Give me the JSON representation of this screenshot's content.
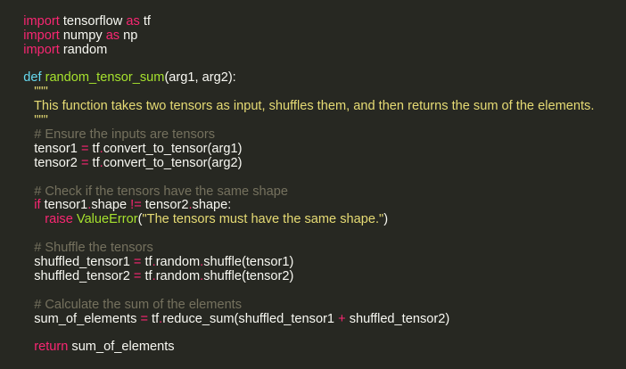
{
  "code": {
    "lines": [
      "import tensorflow as tf",
      "import numpy as np",
      "import random",
      "",
      "def random_tensor_sum(arg1, arg2):",
      "\"\"\"",
      "This function takes two tensors as input, shuffles them, and then returns the sum of the elements.",
      "\"\"\"",
      "# Ensure the inputs are tensors",
      "tensor1 = tf.convert_to_tensor(arg1)",
      "tensor2 = tf.convert_to_tensor(arg2)",
      "",
      "# Check if the tensors have the same shape",
      "if tensor1.shape != tensor2.shape:",
      "raise ValueError(\"The tensors must have the same shape.\")",
      "",
      "# Shuffle the tensors",
      "shuffled_tensor1 = tf.random.shuffle(tensor1)",
      "shuffled_tensor2 = tf.random.shuffle(tensor2)",
      "",
      "# Calculate the sum of the elements",
      "sum_of_elements = tf.reduce_sum(shuffled_tensor1 + shuffled_tensor2)",
      "",
      "return sum_of_elements"
    ],
    "tokens": {
      "import": "import",
      "as": "as",
      "tensorflow": " tensorflow ",
      "tf_alias": " tf",
      "numpy": " numpy ",
      "np_alias": " np",
      "random": " random",
      "def": "def",
      "fn_name": "random_tensor_sum",
      "fn_args": "(arg1, arg2):",
      "docstring_quotes": "\"\"\"",
      "docstring_text": "This function takes two tensors as input, shuffles them, and then returns the sum of the elements.",
      "comment_1": "# Ensure the inputs are tensors",
      "tensor1_assign_left": "tensor1 ",
      "eq": "=",
      "tf": " tf",
      "dot": ".",
      "convert_to_tensor_arg1": "convert_to_tensor(arg1)",
      "tensor2_assign_left": "tensor2 ",
      "convert_to_tensor_arg2": "convert_to_tensor(arg2)",
      "comment_2": "# Check if the tensors have the same shape",
      "if": "if",
      "tensor1_ref": " tensor1",
      "shape": "shape ",
      "ne": "!=",
      "tensor2_ref": " tensor2",
      "shape_colon": "shape:",
      "raise": "raise",
      "value_error": " ValueError",
      "paren_open": "(",
      "raise_string": "\"The tensors must have the same shape.\"",
      "paren_close": ")",
      "comment_3": "# Shuffle the tensors",
      "shuffled_tensor1_left": "shuffled_tensor1 ",
      "random_attr": "random",
      "shuffle_tensor1": "shuffle(tensor1)",
      "shuffled_tensor2_left": "shuffled_tensor2 ",
      "shuffle_tensor2": "shuffle(tensor2)",
      "comment_4": "# Calculate the sum of the elements",
      "sum_left": "sum_of_elements ",
      "reduce_sum_open": "reduce_sum(shuffled_tensor1 ",
      "plus": "+",
      "shuffled_tensor2_close": " shuffled_tensor2)",
      "return": "return",
      "sum_ret": " sum_of_elements"
    }
  },
  "colors": {
    "background": "#272822",
    "foreground": "#f8f8f2",
    "keyword": "#f92672",
    "function": "#a6e22e",
    "definition": "#66d9ef",
    "string": "#e6db74",
    "comment": "#75715e"
  }
}
